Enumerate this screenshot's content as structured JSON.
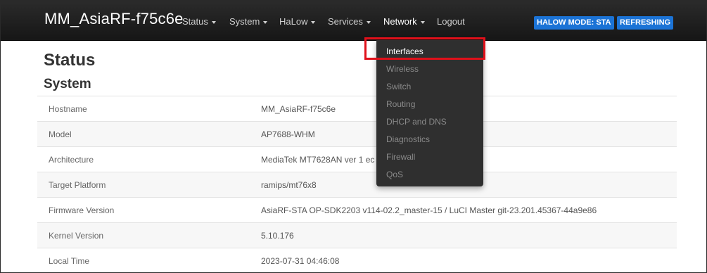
{
  "navbar": {
    "brand": "MM_AsiaRF-f75c6e",
    "menus": [
      {
        "label": "Status"
      },
      {
        "label": "System"
      },
      {
        "label": "HaLow"
      },
      {
        "label": "Services"
      },
      {
        "label": "Network"
      }
    ],
    "logout": "Logout",
    "badges": {
      "mode": "HALOW MODE: STA",
      "refresh": "REFRESHING"
    }
  },
  "page": {
    "title": "Status",
    "section": "System"
  },
  "system_table": [
    {
      "label": "Hostname",
      "value": "MM_AsiaRF-f75c6e"
    },
    {
      "label": "Model",
      "value": "AP7688-WHM"
    },
    {
      "label": "Architecture",
      "value": "MediaTek MT7628AN ver 1 ec"
    },
    {
      "label": "Target Platform",
      "value": "ramips/mt76x8"
    },
    {
      "label": "Firmware Version",
      "value": "AsiaRF-STA OP-SDK2203 v114-02.2_master-15 / LuCI Master git-23.201.45367-44a9e86"
    },
    {
      "label": "Kernel Version",
      "value": "5.10.176"
    },
    {
      "label": "Local Time",
      "value": "2023-07-31 04:46:08"
    }
  ],
  "network_dropdown": {
    "items": [
      {
        "label": "Interfaces"
      },
      {
        "label": "Wireless"
      },
      {
        "label": "Switch"
      },
      {
        "label": "Routing"
      },
      {
        "label": "DHCP and DNS"
      },
      {
        "label": "Diagnostics"
      },
      {
        "label": "Firewall"
      },
      {
        "label": "QoS"
      }
    ]
  },
  "colors": {
    "navbar_bg": "#1c1c1c",
    "badge_bg": "#1b73d6",
    "highlight": "#e0101a",
    "dropdown_bg": "#2f2f2f"
  }
}
